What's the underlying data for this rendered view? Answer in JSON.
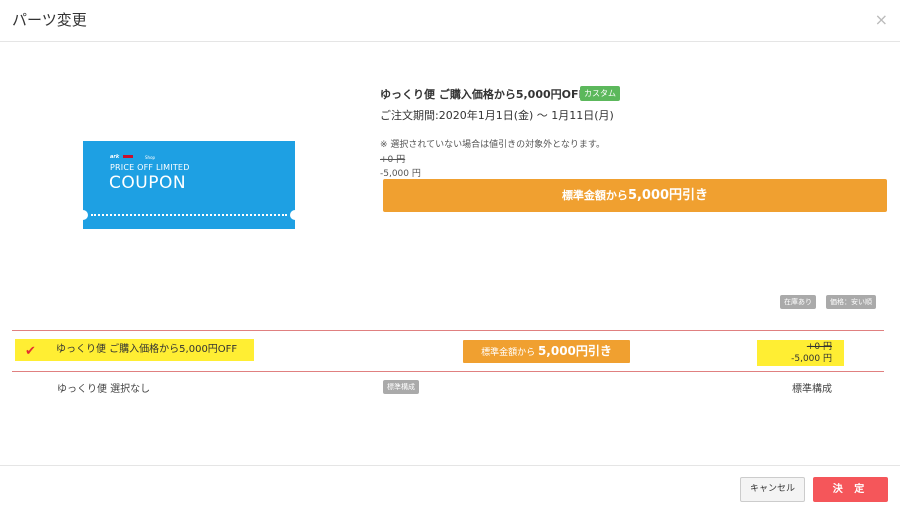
{
  "modal": {
    "title": "パーツ変更",
    "close_glyph": "×"
  },
  "coupon_image": {
    "logo_text": "ark",
    "mini_text": "Shop",
    "subtitle": "PRICE OFF LIMITED",
    "main_text": "COUPON"
  },
  "detail": {
    "name": "ゆっくり便 ご購入価格から5,000円OFF",
    "badge": "カスタム",
    "period": "ご注文期間:2020年1月1日(金) ～ 1月11日(月)",
    "note": "※ 選択されていない場合は値引きの対象外となります。",
    "price_old": "+0 円",
    "price_new": "-5,000 円",
    "discount_prefix": "標準金額から",
    "discount_amount": "5,000円引き"
  },
  "tags": {
    "stock": "在庫あり",
    "sort": "価格：安い順"
  },
  "options": [
    {
      "label": "ゆっくり便 ご購入価格から5,000円OFF",
      "discount_prefix": "標準金額から",
      "discount_amount": "5,000円引き",
      "price_old": "+0 円",
      "price_new": "-5,000 円",
      "selected": true
    },
    {
      "label": "ゆっくり便 選択なし",
      "tag": "標準構成",
      "price": "標準構成",
      "selected": false
    }
  ],
  "footer": {
    "cancel_label": "キャンセル",
    "confirm_label": "決 定"
  },
  "colors": {
    "accent_orange": "#f0a030",
    "confirm_red": "#f5565a",
    "coupon_blue": "#1ea0e3",
    "highlight_yellow": "#ffee33",
    "badge_green": "#5cb85c"
  }
}
